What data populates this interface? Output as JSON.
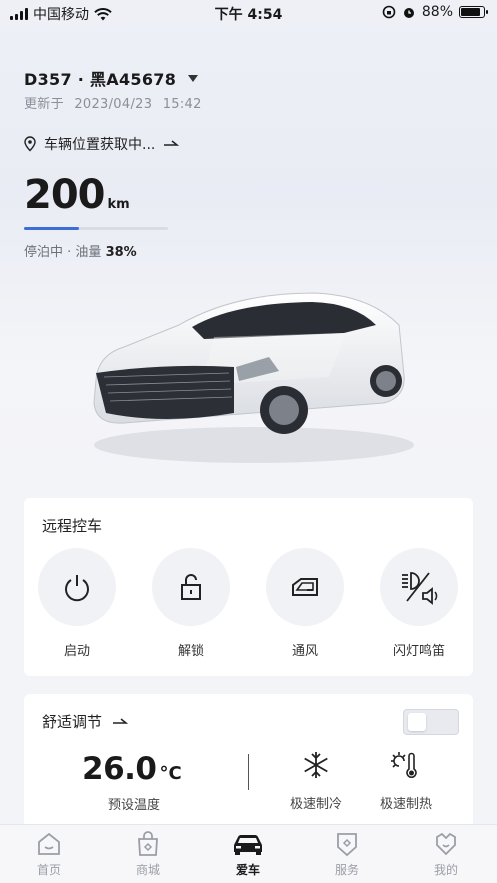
{
  "status_bar": {
    "carrier": "中国移动",
    "time": "下午 4:54",
    "battery": "88%",
    "battery_level": 0.88
  },
  "vehicle": {
    "name": "D357 · 黑A45678",
    "updated_label": "更新于",
    "updated_date": "2023/04/23",
    "updated_time": "15:42",
    "location": "车辆位置获取中...",
    "range_value": "200",
    "range_unit": "km",
    "range_fraction": 0.38,
    "state": "停泊中",
    "fuel_label": "油量",
    "fuel_value": "38%"
  },
  "remote_control": {
    "title": "远程控车",
    "actions": [
      {
        "label": "启动",
        "icon": "power-icon"
      },
      {
        "label": "解锁",
        "icon": "unlock-icon"
      },
      {
        "label": "通风",
        "icon": "window-icon"
      },
      {
        "label": "闪灯鸣笛",
        "icon": "light-horn-icon"
      }
    ]
  },
  "comfort": {
    "title": "舒适调节",
    "toggle_on": false,
    "temperature": "26.0",
    "temperature_unit": "°C",
    "temperature_label": "预设温度",
    "fast_cool": "极速制冷",
    "fast_heat": "极速制热"
  },
  "tabs": [
    {
      "label": "首页",
      "icon": "home-icon"
    },
    {
      "label": "商城",
      "icon": "shop-icon"
    },
    {
      "label": "爱车",
      "icon": "car-icon",
      "active": true
    },
    {
      "label": "服务",
      "icon": "service-icon"
    },
    {
      "label": "我的",
      "icon": "profile-icon"
    }
  ],
  "colors": {
    "accent": "#3b6fd6",
    "background": "#f3f4f7",
    "card": "#ffffff"
  }
}
